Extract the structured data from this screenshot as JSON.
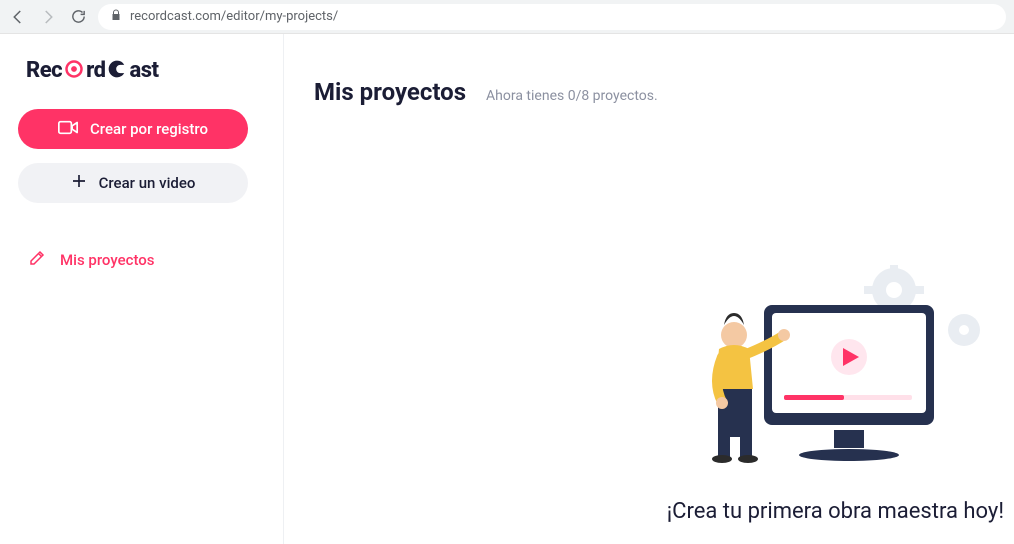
{
  "browser": {
    "url": "recordcast.com/editor/my-projects/"
  },
  "logo": {
    "part1": "Rec",
    "part2": "rd",
    "part3": "ast"
  },
  "sidebar": {
    "record_label": "Crear por registro",
    "video_label": "Crear un video",
    "nav_my_projects": "Mis proyectos"
  },
  "main": {
    "title": "Mis proyectos",
    "subtitle": "Ahora tienes 0/8 proyectos.",
    "empty_caption": "¡Crea tu primera obra maestra hoy!"
  },
  "colors": {
    "accent": "#ff3366",
    "dark": "#1b1d35",
    "muted": "#8b90a0"
  }
}
